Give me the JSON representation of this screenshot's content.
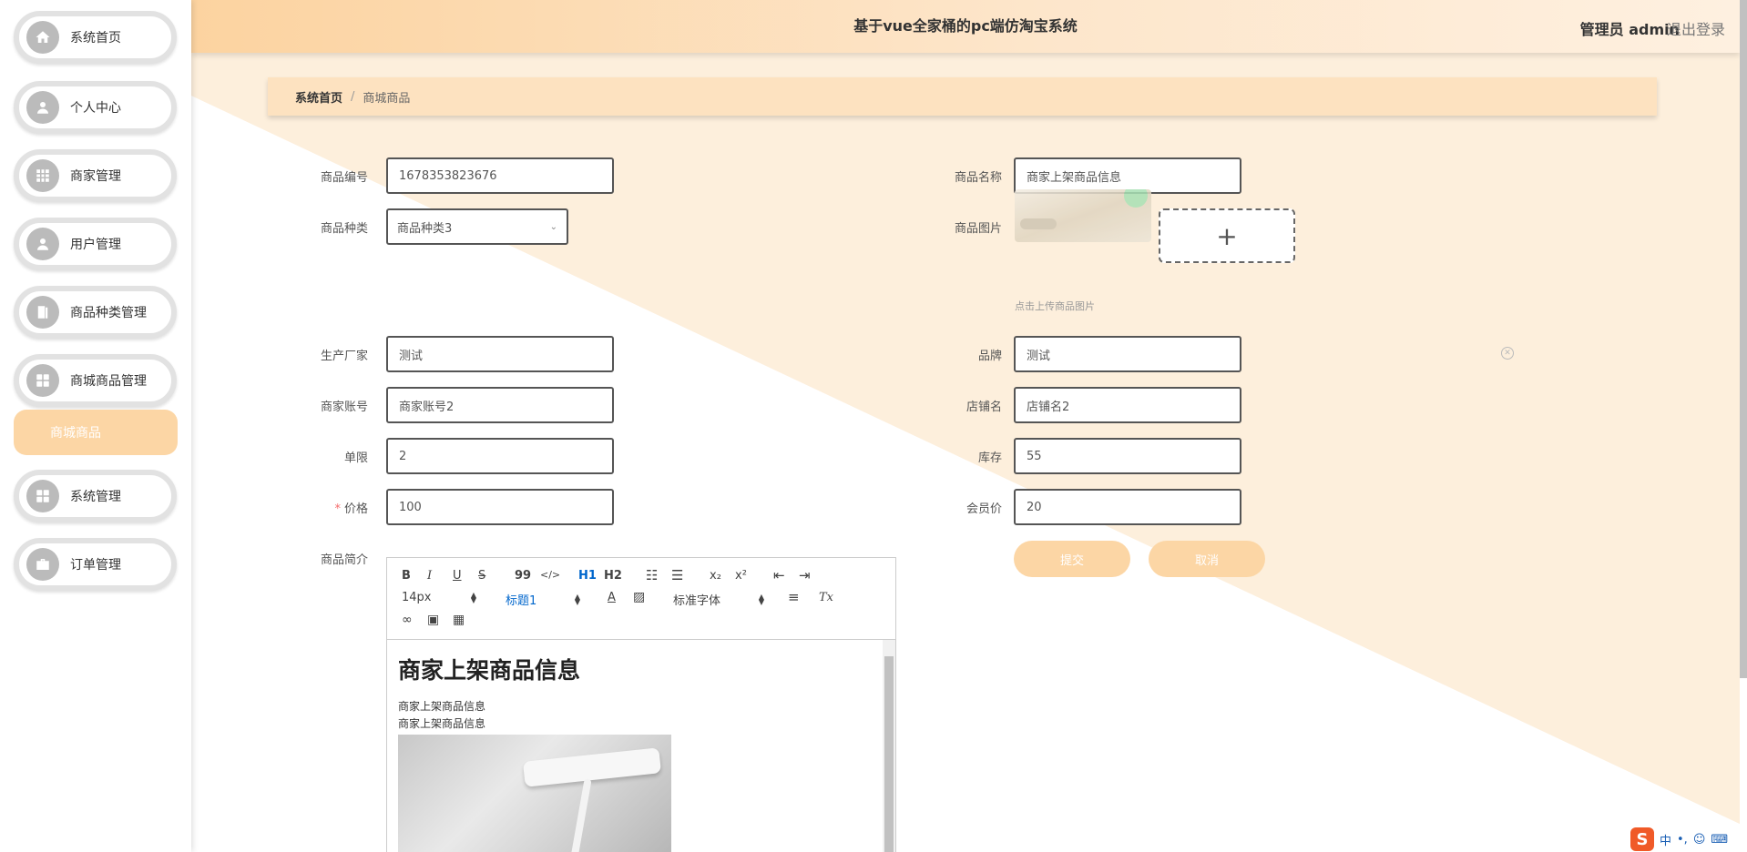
{
  "app": {
    "title": "基于vue全家桶的pc端仿淘宝系统",
    "user_label": "管理员 admin",
    "logout_label": "退出登录"
  },
  "sidebar": {
    "items": [
      {
        "label": "系统首页",
        "icon": "home-icon"
      },
      {
        "label": "个人中心",
        "icon": "user-icon"
      },
      {
        "label": "商家管理",
        "icon": "grid-icon"
      },
      {
        "label": "用户管理",
        "icon": "user-icon"
      },
      {
        "label": "商品种类管理",
        "icon": "book-icon"
      },
      {
        "label": "商城商品管理",
        "icon": "apps-icon"
      },
      {
        "label": "系统管理",
        "icon": "apps-icon"
      },
      {
        "label": "订单管理",
        "icon": "briefcase-icon"
      }
    ],
    "active_sub": "商城商品"
  },
  "breadcrumb": {
    "home": "系统首页",
    "separator": "/",
    "current": "商城商品"
  },
  "form": {
    "code": {
      "label": "商品编号",
      "value": "1678353823676"
    },
    "name": {
      "label": "商品名称",
      "value": "商家上架商品信息"
    },
    "category": {
      "label": "商品种类",
      "value": "商品种类3"
    },
    "image": {
      "label": "商品图片",
      "hint": "点击上传商品图片",
      "add": "+"
    },
    "manufacturer": {
      "label": "生产厂家",
      "value": "测试"
    },
    "brand": {
      "label": "品牌",
      "value": "测试"
    },
    "merchant_account": {
      "label": "商家账号",
      "value": "商家账号2"
    },
    "shop_name": {
      "label": "店铺名",
      "value": "店铺名2"
    },
    "limit": {
      "label": "单限",
      "value": "2"
    },
    "stock": {
      "label": "库存",
      "value": "55"
    },
    "price": {
      "label": "价格",
      "value": "100",
      "required_mark": "*"
    },
    "member_price": {
      "label": "会员价",
      "value": "20"
    },
    "intro": {
      "label": "商品简介"
    },
    "submit_label": "提交",
    "cancel_label": "取消"
  },
  "editor": {
    "toolbar": {
      "bold": "B",
      "italic": "I",
      "underline": "U",
      "strike": "S",
      "quote": "99",
      "code": "</>",
      "h1": "H1",
      "h2": "H2",
      "sub": "x₂",
      "sup": "x²",
      "clear": "Tx",
      "font_size": "14px",
      "heading": "标题1",
      "font_family": "标准字体",
      "color": "A"
    },
    "content": {
      "heading": "商家上架商品信息",
      "lines": [
        "商家上架商品信息",
        "商家上架商品信息"
      ]
    }
  },
  "ime": {
    "logo": "S",
    "lang": "中",
    "punct": "•,"
  },
  "colors": {
    "accent": "#fcd6a5",
    "header": "#fde2c0",
    "triangle": "#fdefdc"
  }
}
